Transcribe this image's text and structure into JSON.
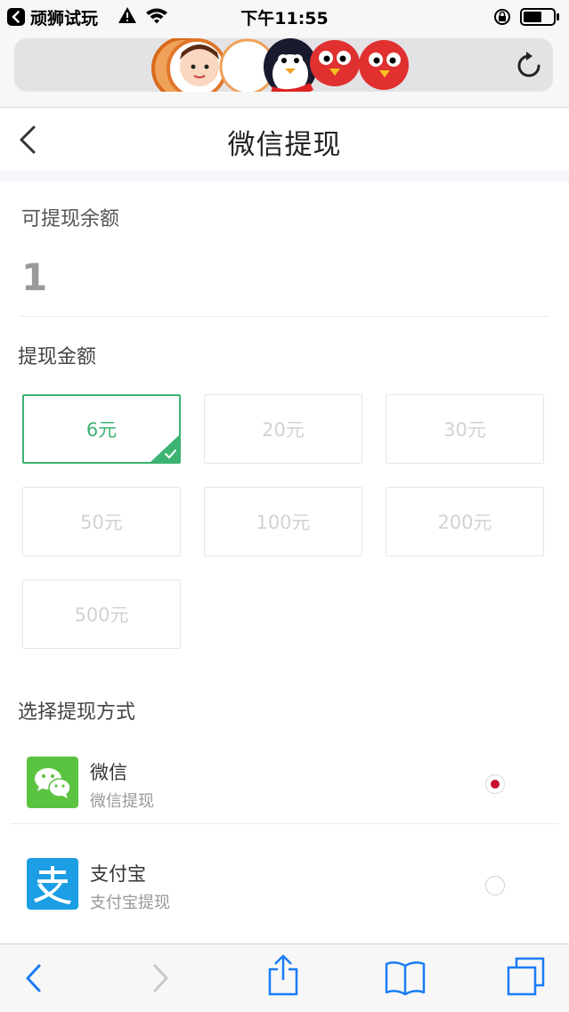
{
  "status_bar": {
    "app_name": "顽狮试玩",
    "time": "下午11:55"
  },
  "page": {
    "title": "微信提现"
  },
  "balance": {
    "label": "可提现余额",
    "value": "1"
  },
  "amount_section": {
    "label": "提现金额",
    "options": [
      "6元",
      "20元",
      "30元",
      "50元",
      "100元",
      "200元",
      "500元"
    ],
    "selected_index": 0
  },
  "method_section": {
    "label": "选择提现方式",
    "methods": [
      {
        "name": "微信",
        "sub": "微信提现",
        "icon": "wechat-icon",
        "color": "#5ac33f",
        "selected": true
      },
      {
        "name": "支付宝",
        "sub": "支付宝提现",
        "icon": "alipay-icon",
        "color": "#1b9ee3",
        "selected": false
      }
    ]
  },
  "colors": {
    "accent_green": "#3cb371",
    "radio_selected": "#c8102e",
    "wechat_green": "#5ac33f",
    "alipay_blue": "#1b9ee3",
    "safari_blue": "#1a7cf5"
  }
}
